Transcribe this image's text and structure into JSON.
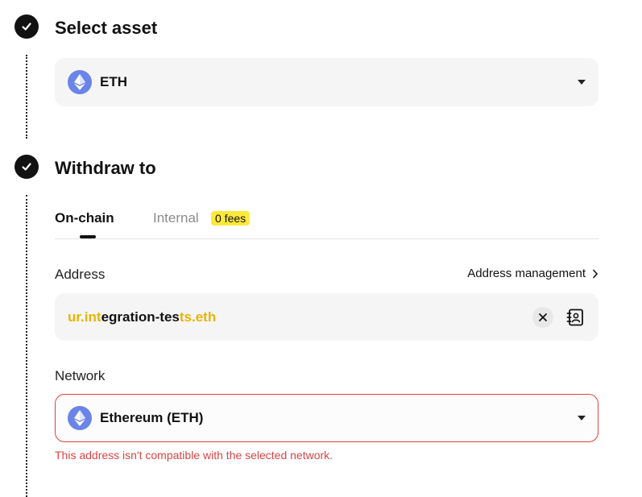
{
  "step1": {
    "title": "Select asset"
  },
  "asset": {
    "icon": "ethereum-icon",
    "label": "ETH"
  },
  "step2": {
    "title": "Withdraw to"
  },
  "tabs": {
    "onchain": "On-chain",
    "internal": "Internal",
    "badge": "0 fees"
  },
  "address": {
    "label": "Address",
    "management_link": "Address management",
    "value_parts": [
      "ur.int",
      "egration-tes",
      "ts.eth"
    ]
  },
  "network": {
    "label": "Network",
    "selected": "Ethereum (ETH)",
    "icon": "ethereum-icon",
    "error": "This address isn't compatible with the selected network."
  },
  "colors": {
    "accent": "#e8b400",
    "error": "#d94444",
    "badge": "#fde93a",
    "eth": "#6a84e8"
  }
}
